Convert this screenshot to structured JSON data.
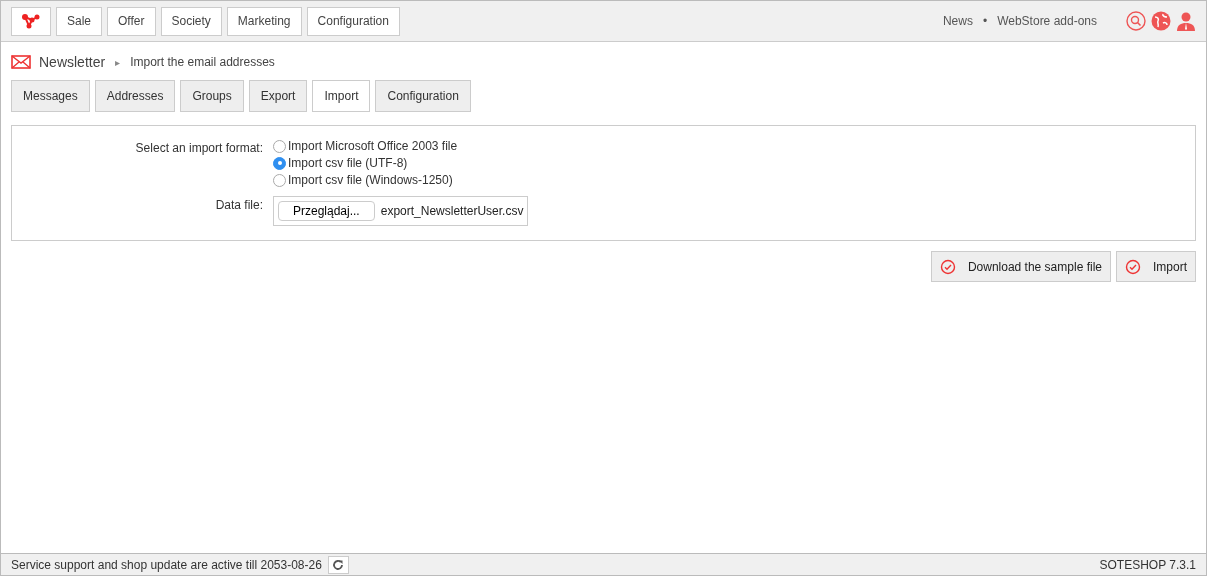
{
  "top_menu": [
    {
      "label": "Sale"
    },
    {
      "label": "Offer"
    },
    {
      "label": "Society"
    },
    {
      "label": "Marketing"
    },
    {
      "label": "Configuration"
    }
  ],
  "top_links": [
    "News",
    "•",
    "WebStore add-ons"
  ],
  "breadcrumb": {
    "section": "Newsletter",
    "separator": "▸",
    "page": "Import the email addresses"
  },
  "tabs": [
    {
      "label": "Messages",
      "selected": false
    },
    {
      "label": "Addresses",
      "selected": false
    },
    {
      "label": "Groups",
      "selected": false
    },
    {
      "label": "Export",
      "selected": false
    },
    {
      "label": "Import",
      "selected": true
    },
    {
      "label": "Configuration",
      "selected": false
    }
  ],
  "form": {
    "format_label": "Select an import format:",
    "formats": [
      {
        "label": "Import Microsoft Office 2003 file",
        "selected": false
      },
      {
        "label": "Import csv file (UTF-8)",
        "selected": true
      },
      {
        "label": "Import csv file (Windows-1250)",
        "selected": false
      }
    ],
    "file_label": "Data file:",
    "browse_button": "Przeglądaj...",
    "file_name": "export_NewsletterUser.csv"
  },
  "actions": [
    "Download the sample file",
    "Import"
  ],
  "status_bar": {
    "text": "Service support and shop update are active till 2053-08-26",
    "version": "SOTESHOP 7.3.1"
  }
}
